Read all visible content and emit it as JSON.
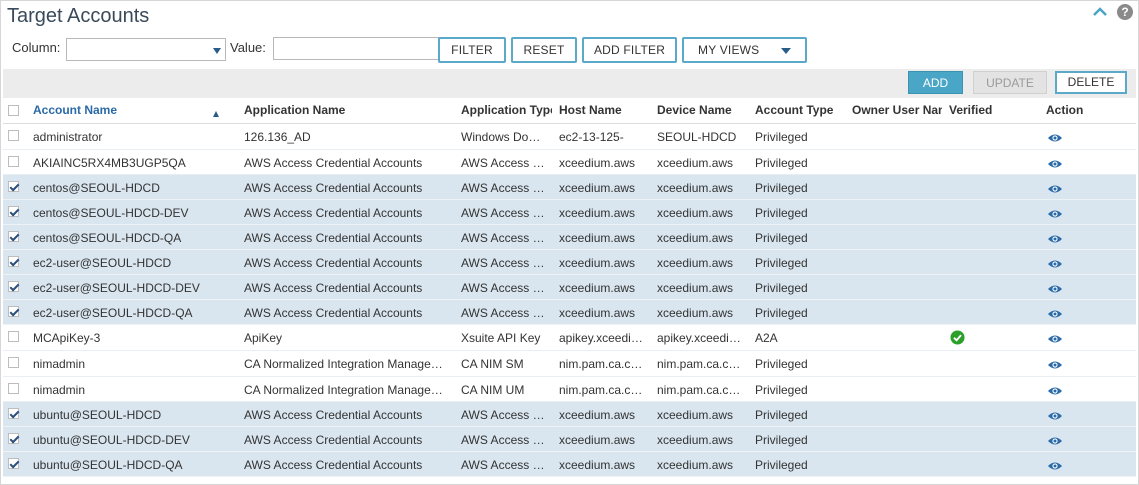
{
  "title": "Target Accounts",
  "icons": {
    "collapse": "chevron-up-icon",
    "help": "help-icon",
    "view": "eye-icon",
    "verified": "check-circle-icon"
  },
  "colors": {
    "accent": "#4aa6c6",
    "selected_row": "#d9e6ef",
    "link": "#2a6aa8",
    "verified": "#2aa02a"
  },
  "filter": {
    "column_label": "Column:",
    "column_value": "",
    "value_label": "Value:",
    "value_input": "",
    "buttons": {
      "filter": "FILTER",
      "reset": "RESET",
      "add_filter": "ADD FILTER",
      "my_views": "MY VIEWS"
    }
  },
  "toolbar": {
    "add": "ADD",
    "update": "UPDATE",
    "delete": "DELETE"
  },
  "columns": {
    "account_name": "Account Name",
    "application_name": "Application Name",
    "application_type": "Application Type",
    "host_name": "Host Name",
    "device_name": "Device Name",
    "account_type": "Account Type",
    "owner_user_name": "Owner User Name",
    "verified": "Verified",
    "action": "Action"
  },
  "help_glyph": "?",
  "rows": [
    {
      "checked": false,
      "account": "administrator",
      "app": "126.136_AD",
      "app_type": "Windows Domain",
      "host": "ec2-13-125-",
      "device": "SEOUL-HDCD",
      "acct_type": "Privileged",
      "owner": "",
      "verified": false
    },
    {
      "checked": false,
      "account": "AKIAINC5RX4MB3UGP5QA",
      "app": "AWS Access Credential Accounts",
      "app_type": "AWS Access Credential",
      "host": "xceedium.aws",
      "device": "xceedium.aws",
      "acct_type": "Privileged",
      "owner": "",
      "verified": false
    },
    {
      "checked": true,
      "account": "centos@SEOUL-HDCD",
      "app": "AWS Access Credential Accounts",
      "app_type": "AWS Access Credential",
      "host": "xceedium.aws",
      "device": "xceedium.aws",
      "acct_type": "Privileged",
      "owner": "",
      "verified": false
    },
    {
      "checked": true,
      "account": "centos@SEOUL-HDCD-DEV",
      "app": "AWS Access Credential Accounts",
      "app_type": "AWS Access Credential",
      "host": "xceedium.aws",
      "device": "xceedium.aws",
      "acct_type": "Privileged",
      "owner": "",
      "verified": false
    },
    {
      "checked": true,
      "account": "centos@SEOUL-HDCD-QA",
      "app": "AWS Access Credential Accounts",
      "app_type": "AWS Access Credential",
      "host": "xceedium.aws",
      "device": "xceedium.aws",
      "acct_type": "Privileged",
      "owner": "",
      "verified": false
    },
    {
      "checked": true,
      "account": "ec2-user@SEOUL-HDCD",
      "app": "AWS Access Credential Accounts",
      "app_type": "AWS Access Credential",
      "host": "xceedium.aws",
      "device": "xceedium.aws",
      "acct_type": "Privileged",
      "owner": "",
      "verified": false
    },
    {
      "checked": true,
      "account": "ec2-user@SEOUL-HDCD-DEV",
      "app": "AWS Access Credential Accounts",
      "app_type": "AWS Access Credential",
      "host": "xceedium.aws",
      "device": "xceedium.aws",
      "acct_type": "Privileged",
      "owner": "",
      "verified": false
    },
    {
      "checked": true,
      "account": "ec2-user@SEOUL-HDCD-QA",
      "app": "AWS Access Credential Accounts",
      "app_type": "AWS Access Credential",
      "host": "xceedium.aws",
      "device": "xceedium.aws",
      "acct_type": "Privileged",
      "owner": "",
      "verified": false
    },
    {
      "checked": false,
      "account": "MCApiKey-3",
      "app": "ApiKey",
      "app_type": "Xsuite API Key",
      "host": "apikey.xceedium",
      "device": "apikey.xceedium",
      "acct_type": "A2A",
      "owner": "",
      "verified": true
    },
    {
      "checked": false,
      "account": "nimadmin",
      "app": "CA Normalized Integration Management",
      "app_type": "CA NIM SM",
      "host": "nim.pam.ca.com",
      "device": "nim.pam.ca.com",
      "acct_type": "Privileged",
      "owner": "",
      "verified": false
    },
    {
      "checked": false,
      "account": "nimadmin",
      "app": "CA Normalized Integration Management",
      "app_type": "CA NIM UM",
      "host": "nim.pam.ca.com",
      "device": "nim.pam.ca.com",
      "acct_type": "Privileged",
      "owner": "",
      "verified": false
    },
    {
      "checked": true,
      "account": "ubuntu@SEOUL-HDCD",
      "app": "AWS Access Credential Accounts",
      "app_type": "AWS Access Credential",
      "host": "xceedium.aws",
      "device": "xceedium.aws",
      "acct_type": "Privileged",
      "owner": "",
      "verified": false
    },
    {
      "checked": true,
      "account": "ubuntu@SEOUL-HDCD-DEV",
      "app": "AWS Access Credential Accounts",
      "app_type": "AWS Access Credential",
      "host": "xceedium.aws",
      "device": "xceedium.aws",
      "acct_type": "Privileged",
      "owner": "",
      "verified": false
    },
    {
      "checked": true,
      "account": "ubuntu@SEOUL-HDCD-QA",
      "app": "AWS Access Credential Accounts",
      "app_type": "AWS Access Credential",
      "host": "xceedium.aws",
      "device": "xceedium.aws",
      "acct_type": "Privileged",
      "owner": "",
      "verified": false
    }
  ]
}
